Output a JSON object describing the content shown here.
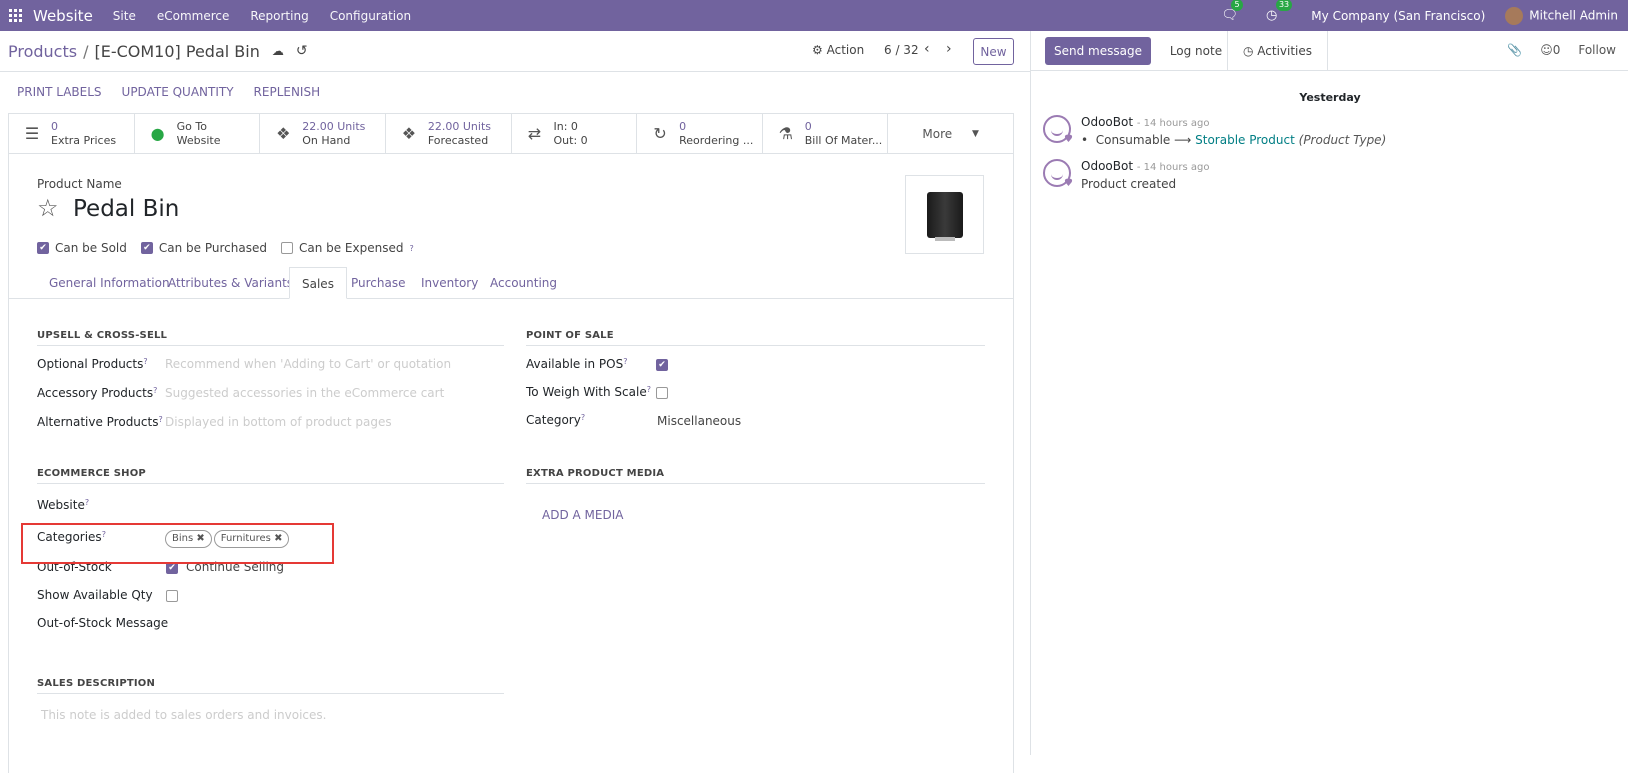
{
  "topbar": {
    "app_name": "Website",
    "menus": [
      "Site",
      "eCommerce",
      "Reporting",
      "Configuration"
    ],
    "messages_badge": "5",
    "activities_badge": "33",
    "company": "My Company (San Francisco)",
    "user": "Mitchell Admin"
  },
  "control": {
    "breadcrumb_root": "Products",
    "breadcrumb_sep": "/",
    "breadcrumb_current": "[E-COM10] Pedal Bin",
    "action_label": "Action",
    "pager": "6 / 32",
    "new_label": "New"
  },
  "statusbar": {
    "buttons": [
      "PRINT LABELS",
      "UPDATE QUANTITY",
      "REPLENISH"
    ]
  },
  "smart_buttons": [
    {
      "value": "0",
      "label": "Extra Prices",
      "icon": "list-icon"
    },
    {
      "value": "Go To",
      "label": "Website",
      "icon": "globe-icon"
    },
    {
      "value": "22.00 Units",
      "label": "On Hand",
      "icon": "cubes-icon"
    },
    {
      "value": "22.00 Units",
      "label": "Forecasted",
      "icon": "cubes-icon"
    },
    {
      "value": "In:  0",
      "label": "Out:  0",
      "icon": "exchange-icon"
    },
    {
      "value": "0",
      "label": "Reordering ...",
      "icon": "refresh-icon"
    },
    {
      "value": "0",
      "label": "Bill Of Mater...",
      "icon": "flask-icon"
    }
  ],
  "more_label": "More",
  "product": {
    "name_label": "Product Name",
    "name": "Pedal Bin",
    "can_be_sold": "Can be Sold",
    "can_be_purchased": "Can be Purchased",
    "can_be_expensed": "Can be Expensed",
    "help": "?"
  },
  "tabs": [
    "General Information",
    "Attributes & Variants",
    "Sales",
    "Purchase",
    "Inventory",
    "Accounting"
  ],
  "active_tab": "Sales",
  "sales": {
    "upsell_title": "UPSELL & CROSS-SELL",
    "optional_products": "Optional Products",
    "optional_products_ph": "Recommend when 'Adding to Cart' or quotation",
    "accessory_products": "Accessory Products",
    "accessory_products_ph": "Suggested accessories in the eCommerce cart",
    "alternative_products": "Alternative Products",
    "alternative_products_ph": "Displayed in bottom of product pages",
    "pos_title": "POINT OF SALE",
    "available_in_pos": "Available in POS",
    "to_weigh": "To Weigh With Scale",
    "category_label": "Category",
    "category_value": "Miscellaneous",
    "ecommerce_title": "ECOMMERCE SHOP",
    "website_label": "Website",
    "categories_label": "Categories",
    "tags": [
      "Bins",
      "Furnitures"
    ],
    "out_of_stock": "Out-of-Stock",
    "continue_selling": "Continue Selling",
    "show_available_qty": "Show Available Qty",
    "out_of_stock_message": "Out-of-Stock Message",
    "extra_media_title": "EXTRA PRODUCT MEDIA",
    "add_media": "ADD A MEDIA",
    "sales_desc_title": "SALES DESCRIPTION",
    "sales_desc_ph": "This note is added to sales orders and invoices."
  },
  "chatter": {
    "send_message": "Send message",
    "log_note": "Log note",
    "activities": "Activities",
    "followers_count": "0",
    "follow": "Follow",
    "day_label": "Yesterday",
    "messages": [
      {
        "author": "OdooBot",
        "time": "- 14 hours ago",
        "old": "Consumable",
        "new": "Storable Product",
        "field": "(Product Type)"
      },
      {
        "author": "OdooBot",
        "time": "- 14 hours ago",
        "body": "Product created"
      }
    ]
  },
  "colors": {
    "brand": "#71639e",
    "highlight": "#e53935",
    "link": "#017e84"
  }
}
